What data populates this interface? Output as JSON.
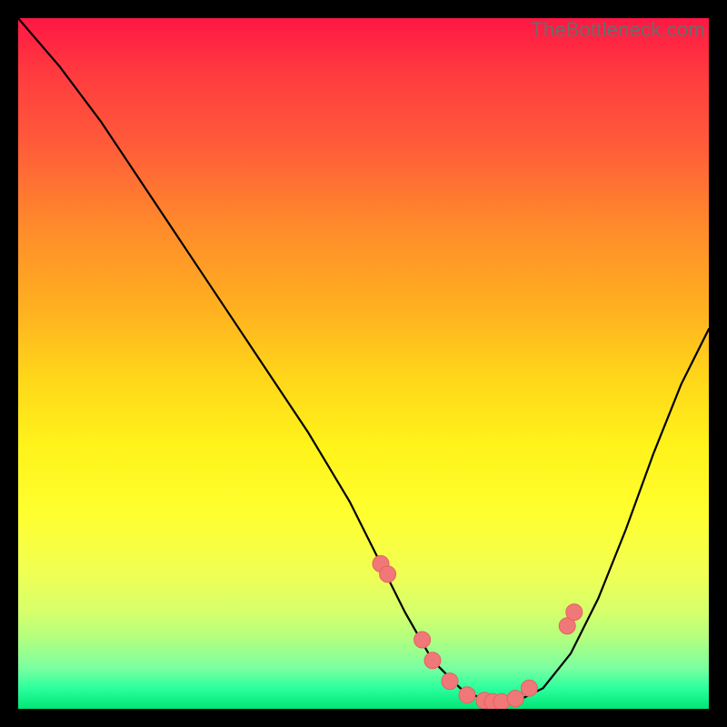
{
  "watermark": "TheBottleneck.com",
  "colors": {
    "curve": "#000000",
    "marker_fill": "#f07878",
    "marker_stroke": "#e86060"
  },
  "chart_data": {
    "type": "line",
    "title": "",
    "xlabel": "",
    "ylabel": "",
    "xlim": [
      0,
      100
    ],
    "ylim": [
      0,
      100
    ],
    "curve": {
      "x": [
        0,
        6,
        12,
        18,
        24,
        30,
        36,
        42,
        48,
        52,
        56,
        60,
        64,
        68,
        72,
        76,
        80,
        84,
        88,
        92,
        96,
        100
      ],
      "y": [
        100,
        93,
        85,
        76,
        67,
        58,
        49,
        40,
        30,
        22,
        14,
        7,
        3,
        1,
        1,
        3,
        8,
        16,
        26,
        37,
        47,
        55
      ]
    },
    "markers": {
      "x": [
        52.5,
        53.5,
        58.5,
        60.0,
        62.5,
        65.0,
        67.5,
        68.7,
        70.0,
        72.0,
        74.0,
        79.5,
        80.5
      ],
      "y": [
        21.0,
        19.5,
        10.0,
        7.0,
        4.0,
        2.0,
        1.2,
        1.0,
        1.0,
        1.5,
        3.0,
        12.0,
        14.0
      ]
    }
  }
}
